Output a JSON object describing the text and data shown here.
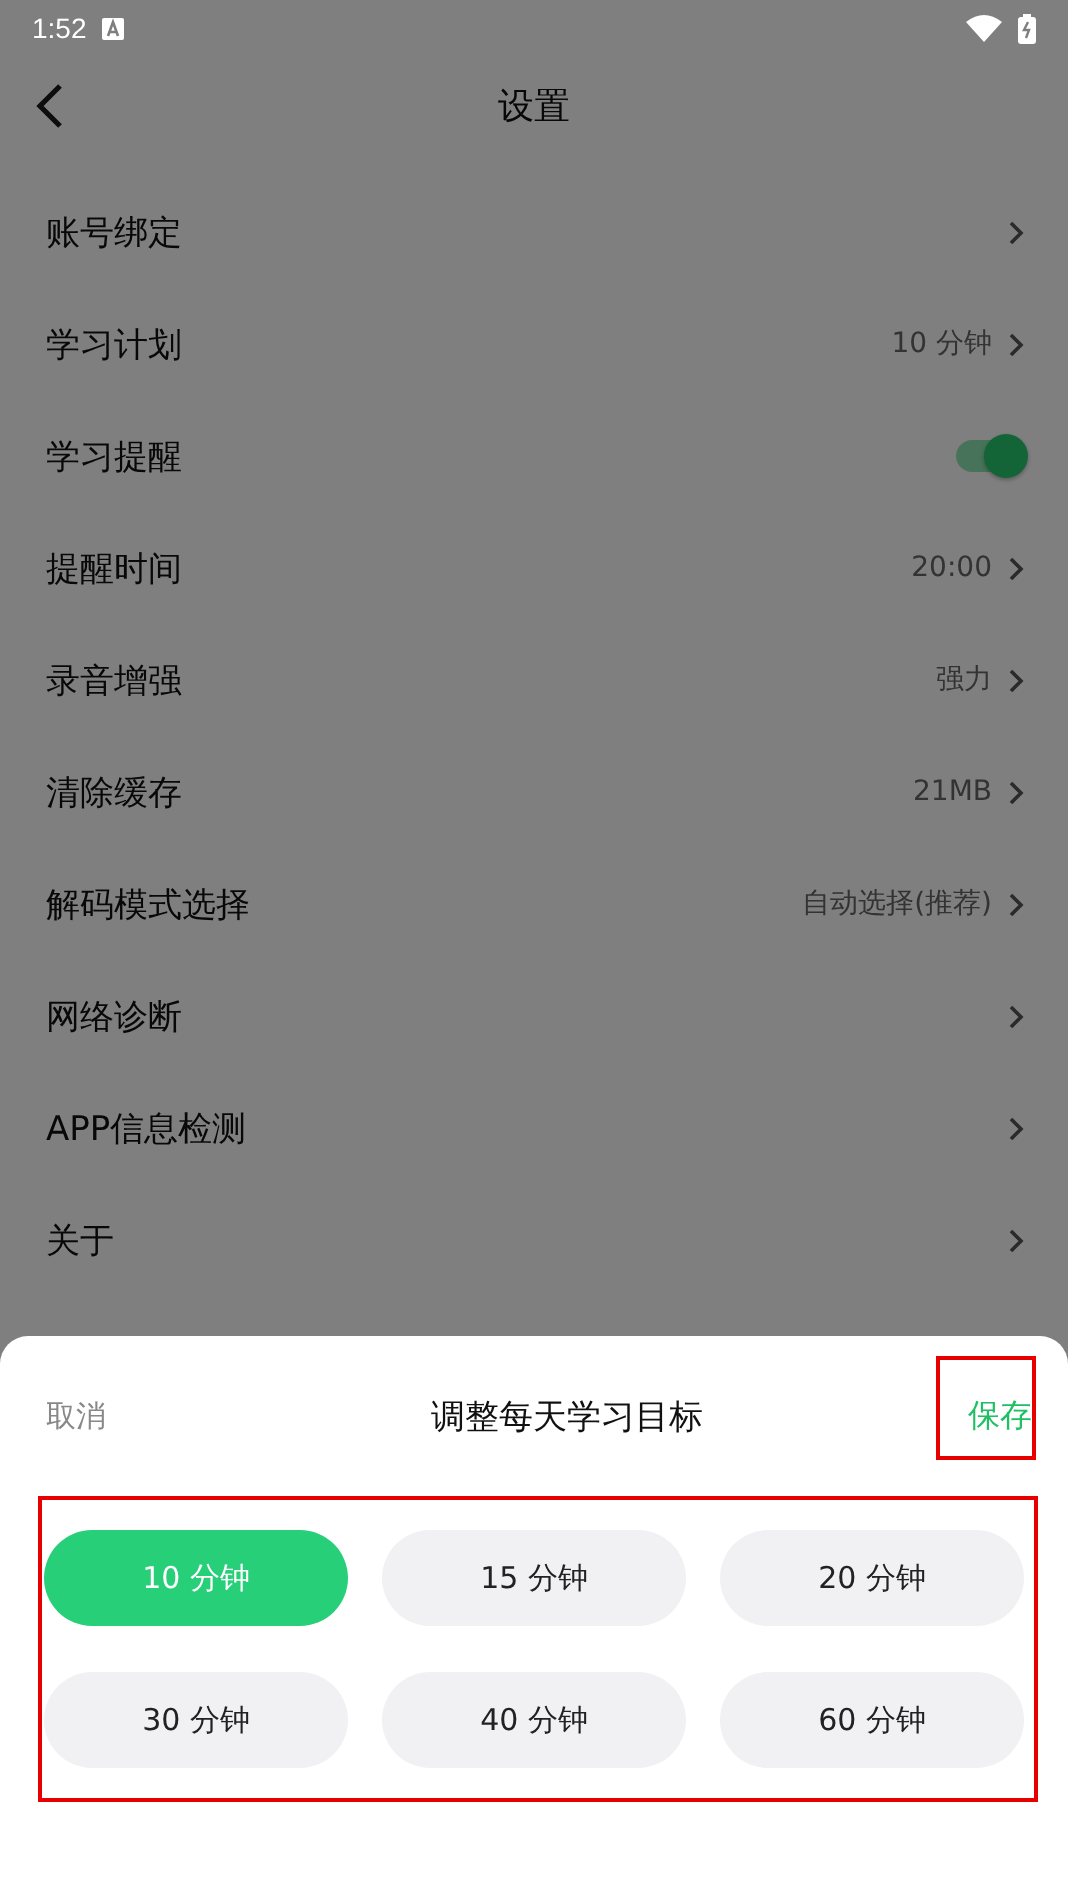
{
  "status_bar": {
    "time": "1:52"
  },
  "header": {
    "title": "设置"
  },
  "settings": [
    {
      "label": "账号绑定",
      "kind": "arrow"
    },
    {
      "label": "学习计划",
      "kind": "arrow",
      "value": "10 分钟"
    },
    {
      "label": "学习提醒",
      "kind": "toggle",
      "on": true
    },
    {
      "label": "提醒时间",
      "kind": "arrow",
      "value": "20:00"
    },
    {
      "label": "录音增强",
      "kind": "arrow",
      "value": "强力"
    },
    {
      "label": "清除缓存",
      "kind": "arrow",
      "value": "21MB"
    },
    {
      "label": "解码模式选择",
      "kind": "arrow",
      "value": "自动选择(推荐)"
    },
    {
      "label": "网络诊断",
      "kind": "arrow"
    },
    {
      "label": "APP信息检测",
      "kind": "arrow"
    },
    {
      "label": "关于",
      "kind": "arrow"
    }
  ],
  "sheet": {
    "cancel": "取消",
    "title": "调整每天学习目标",
    "save": "保存",
    "options": [
      {
        "label": "10 分钟",
        "selected": true
      },
      {
        "label": "15 分钟",
        "selected": false
      },
      {
        "label": "20 分钟",
        "selected": false
      },
      {
        "label": "30 分钟",
        "selected": false
      },
      {
        "label": "40 分钟",
        "selected": false
      },
      {
        "label": "60 分钟",
        "selected": false
      }
    ]
  }
}
